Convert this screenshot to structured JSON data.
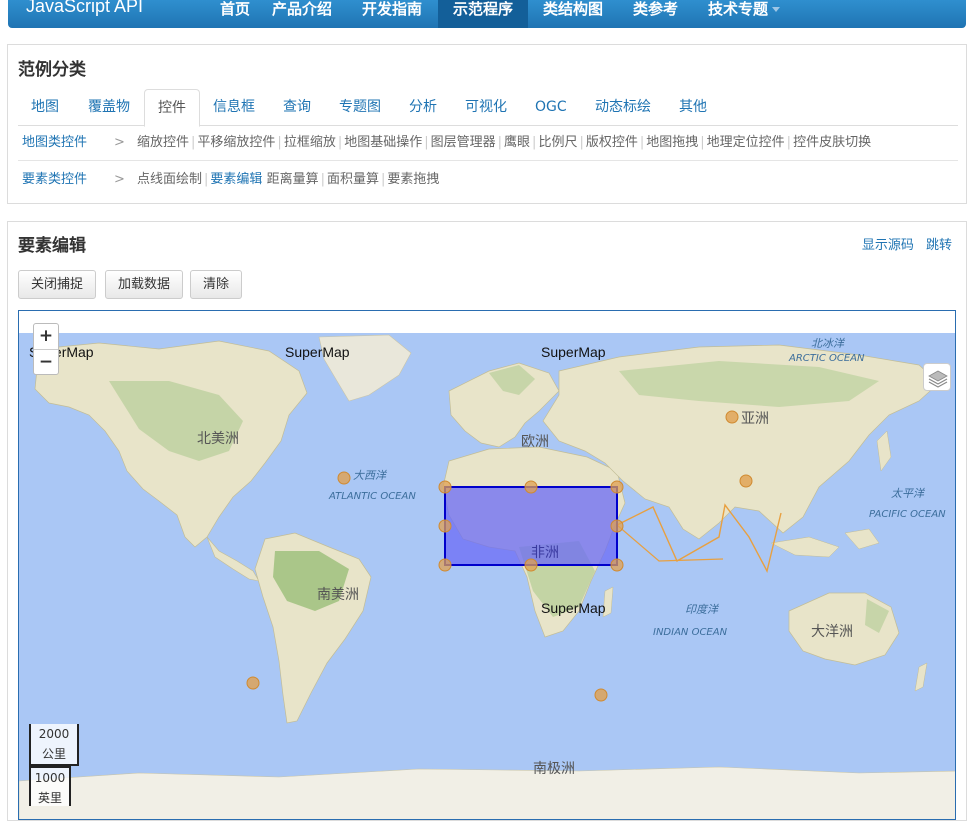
{
  "nav": {
    "brand": "JavaScript API",
    "items": [
      "首页",
      "产品介绍",
      "开发指南",
      "示范程序",
      "类结构图",
      "类参考",
      "技术专题"
    ],
    "active_index": 3
  },
  "category": {
    "title": "范例分类",
    "tabs": [
      "地图",
      "覆盖物",
      "控件",
      "信息框",
      "查询",
      "专题图",
      "分析",
      "可视化",
      "OGC",
      "动态标绘",
      "其他"
    ],
    "active_tab": 2,
    "rows": [
      {
        "label": "地图类控件",
        "arrow": ">",
        "links": [
          "缩放控件",
          "平移缩放控件",
          "拉框缩放",
          "地图基础操作",
          "图层管理器",
          "鹰眼",
          "比例尺",
          "版权控件",
          "地图拖拽",
          "地理定位控件",
          "控件皮肤切换"
        ]
      },
      {
        "label": "要素类控件",
        "arrow": ">",
        "links": [
          "点线面绘制",
          "要素编辑",
          "距离量算",
          "面积量算",
          "要素拖拽"
        ],
        "current": 1
      }
    ]
  },
  "demo": {
    "title": "要素编辑",
    "show_source": "显示源码",
    "jump": "跳转",
    "buttons": {
      "close_snap": "关闭捕捉",
      "load_data": "加载数据",
      "clear": "清除"
    }
  },
  "map": {
    "zoom_in": "+",
    "zoom_out": "−",
    "watermarks": [
      "SuperMap",
      "SuperMap",
      "SuperMap",
      "SuperMap"
    ],
    "labels": {
      "arctic_cn": "北冰洋",
      "arctic_en": "ARCTIC OCEAN",
      "north_america": "北美洲",
      "europe": "欧洲",
      "asia": "亚洲",
      "atlantic_cn": "大西洋",
      "atlantic_en": "ATLANTIC OCEAN",
      "pacific_cn": "太平洋",
      "pacific_en": "PACIFIC OCEAN",
      "africa": "非洲",
      "south_america": "南美洲",
      "indian_cn": "印度洋",
      "indian_en": "INDIAN OCEAN",
      "oceania": "大洋洲",
      "antarctica": "南极洲"
    },
    "scale_metric": "2000 公里",
    "scale_imperial": "1000 英里",
    "colors": {
      "ocean": "#aac7f5",
      "land": "#e8e4c9",
      "vegetation": "#b9cf9b",
      "polygon_fill": "#6b6bf5",
      "polygon_stroke": "#0000cc",
      "point": "#e0a050",
      "line": "#e8a040"
    }
  }
}
